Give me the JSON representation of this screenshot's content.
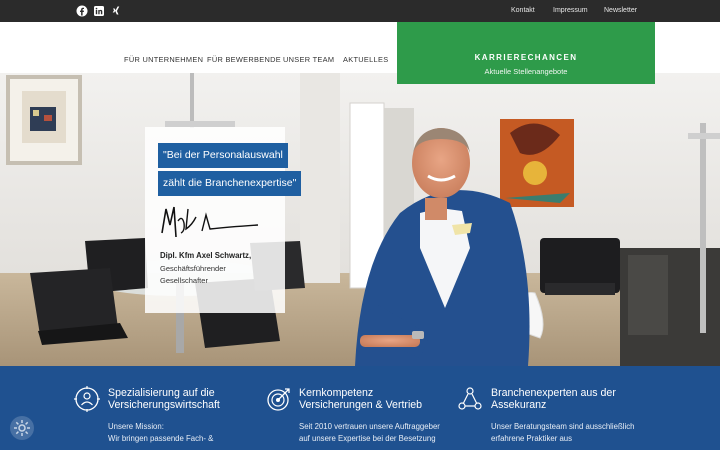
{
  "topbar": {
    "social": [
      "facebook-icon",
      "linkedin-icon",
      "xing-icon"
    ],
    "links": [
      "Kontakt",
      "Impressum",
      "Newsletter"
    ]
  },
  "nav": {
    "items": [
      "FÜR UNTERNEHMEN",
      "FÜR BEWERBENDE",
      "UNSER TEAM",
      "AKTUELLES"
    ],
    "cta_title": "KARRIERECHANCEN",
    "cta_sub": "Aktuelle Stellenangebote"
  },
  "hero": {
    "quote_line1": "\"Bei der Personalauswahl",
    "quote_line2": "zählt die Branchenexpertise\"",
    "name": "Dipl. Kfm Axel Schwartz,",
    "role1": "Geschäftsführender",
    "role2": "Gesellschafter"
  },
  "features": [
    {
      "icon": "person-target-icon",
      "title1": "Spezialisierung auf die",
      "title2": "Versicherungswirtschaft",
      "text1": "Unsere Mission:",
      "text2": "Wir bringen passende Fach- &"
    },
    {
      "icon": "target-arrow-icon",
      "title1": "Kernkompetenz",
      "title2": "Versicherungen & Vertrieb",
      "text1": "Seit 2010 vertrauen unsere Auftraggeber",
      "text2": "auf unsere Expertise bei der Besetzung"
    },
    {
      "icon": "team-network-icon",
      "title1": "Branchenexperten aus der",
      "title2": "Assekuranz",
      "text1": "Unser Beratungsteam sind ausschließlich",
      "text2": "erfahrene Praktiker aus"
    }
  ],
  "colors": {
    "topbar": "#2b2b2b",
    "accent_green": "#2e9b4a",
    "quote_blue": "#1f5fa1",
    "feature_band": "#1f5190"
  }
}
